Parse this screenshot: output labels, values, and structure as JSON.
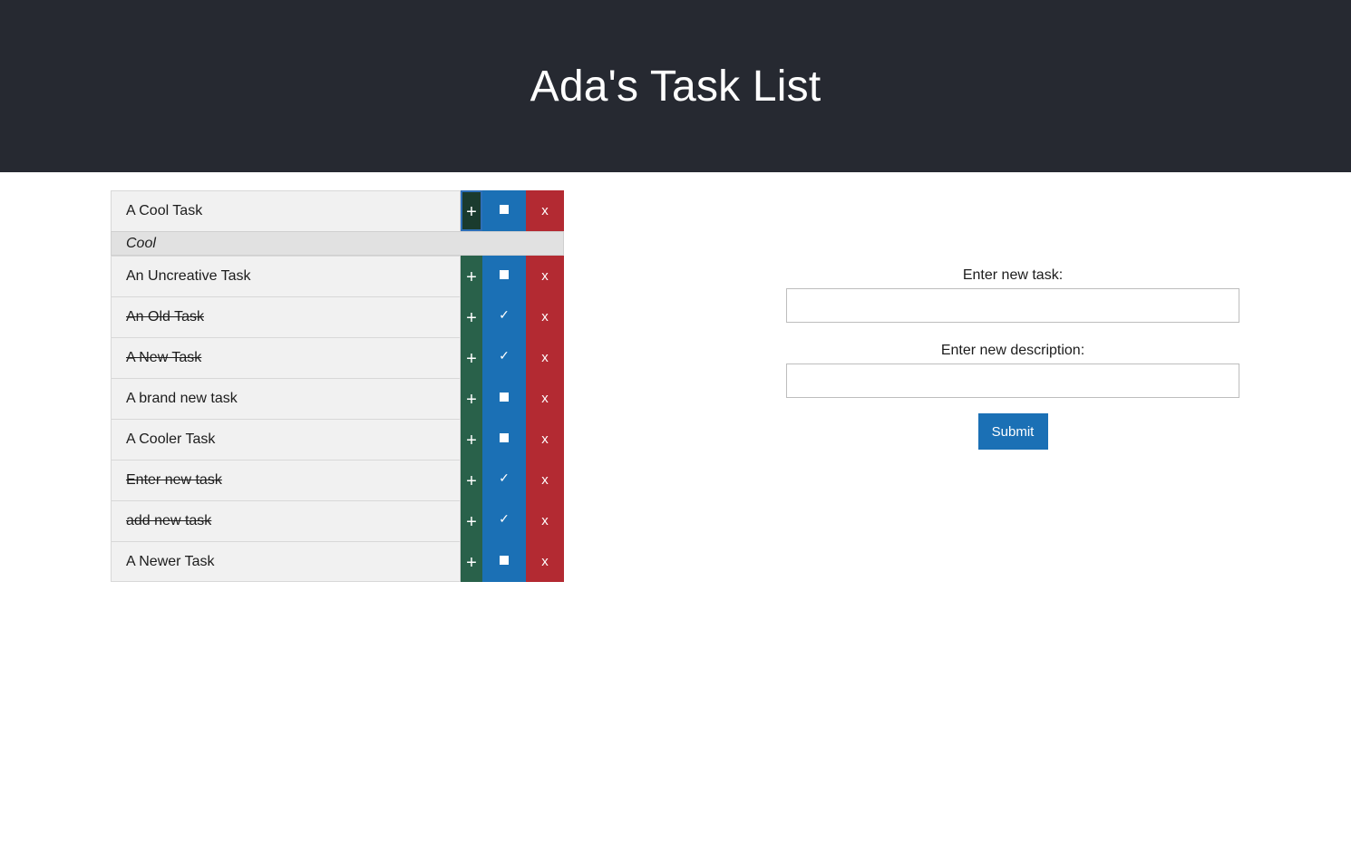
{
  "header": {
    "title": "Ada's Task List"
  },
  "tasks": [
    {
      "title": "A Cool Task",
      "done": false,
      "description": "Cool",
      "add_label": "+",
      "delete_label": "x"
    },
    {
      "title": "An Uncreative Task",
      "done": false,
      "add_label": "+",
      "delete_label": "x"
    },
    {
      "title": "An Old Task",
      "done": true,
      "add_label": "+",
      "delete_label": "x"
    },
    {
      "title": "A New Task",
      "done": true,
      "add_label": "+",
      "delete_label": "x"
    },
    {
      "title": "A brand new task",
      "done": false,
      "add_label": "+",
      "delete_label": "x"
    },
    {
      "title": "A Cooler Task",
      "done": false,
      "add_label": "+",
      "delete_label": "x"
    },
    {
      "title": "Enter new task",
      "done": true,
      "add_label": "+",
      "delete_label": "x"
    },
    {
      "title": "add new task",
      "done": true,
      "add_label": "+",
      "delete_label": "x"
    },
    {
      "title": "A Newer Task",
      "done": false,
      "add_label": "+",
      "delete_label": "x"
    }
  ],
  "icons": {
    "done": "checkmark-icon",
    "not_done": "square-icon"
  },
  "form": {
    "task_label": "Enter new task:",
    "task_value": "",
    "description_label": "Enter new description:",
    "description_value": "",
    "submit_label": "Submit"
  },
  "colors": {
    "header_bg": "#262931",
    "add_button": "#29614a",
    "toggle_button": "#1b70b5",
    "delete_button": "#b32a32",
    "submit_button": "#1b70b5"
  }
}
